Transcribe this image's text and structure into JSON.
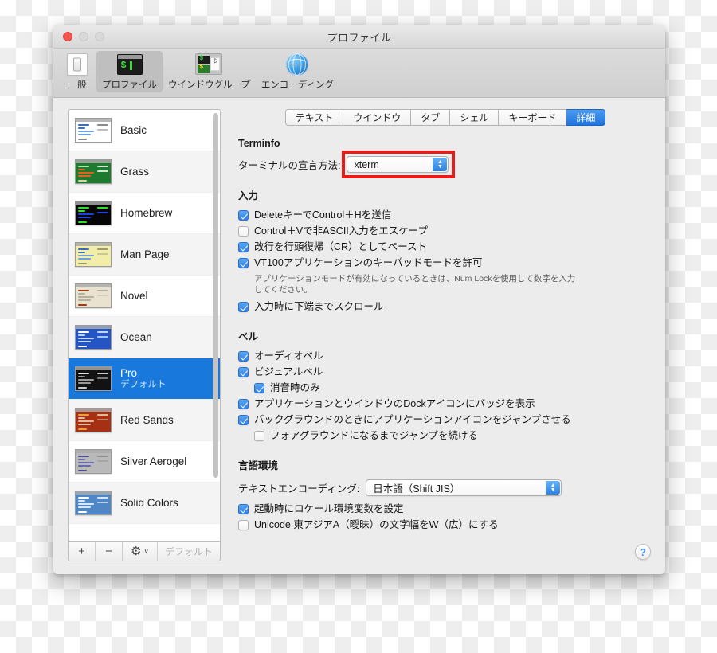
{
  "window": {
    "title": "プロファイル",
    "traffic_lights": [
      "close",
      "minimize",
      "zoom"
    ]
  },
  "toolbar": {
    "items": [
      {
        "label": "一般",
        "icon": "general-icon"
      },
      {
        "label": "プロファイル",
        "icon": "profile-terminal-icon"
      },
      {
        "label": "ウインドウグループ",
        "icon": "window-group-icon"
      },
      {
        "label": "エンコーディング",
        "icon": "globe-icon"
      }
    ],
    "selected_index": 1
  },
  "sidebar": {
    "profiles": [
      {
        "name": "Basic",
        "sub": "",
        "thumb_bg": "#ffffff",
        "thumb_fg": "#4a7fc9"
      },
      {
        "name": "Grass",
        "sub": "",
        "thumb_bg": "#1d7a2e",
        "thumb_fg": "#e8601c"
      },
      {
        "name": "Homebrew",
        "sub": "",
        "thumb_bg": "#060606",
        "thumb_fg": "#1f41e0"
      },
      {
        "name": "Man Page",
        "sub": "",
        "thumb_bg": "#f3edaa",
        "thumb_fg": "#4a7fc9"
      },
      {
        "name": "Novel",
        "sub": "",
        "thumb_bg": "#e8e2cf",
        "thumb_fg": "#9a3d12"
      },
      {
        "name": "Ocean",
        "sub": "",
        "thumb_bg": "#2554c4",
        "thumb_fg": "#9fc6f5"
      },
      {
        "name": "Pro",
        "sub": "デフォルト",
        "thumb_bg": "#121212",
        "thumb_fg": "#c9c9c9"
      },
      {
        "name": "Red Sands",
        "sub": "",
        "thumb_bg": "#a63014",
        "thumb_fg": "#e8a03a"
      },
      {
        "name": "Silver Aerogel",
        "sub": "",
        "thumb_bg": "#b9b9b9",
        "thumb_fg": "#4a4a8c"
      },
      {
        "name": "Solid Colors",
        "sub": "",
        "thumb_bg": "#4f86c6",
        "thumb_fg": "#d7e6f7"
      }
    ],
    "selected_index": 6,
    "list_toolbar": {
      "add_label": "+",
      "remove_label": "−",
      "gear_label": "⚙",
      "gear_chevron": "∨",
      "default_label": "デフォルト"
    }
  },
  "pane": {
    "tabs": [
      {
        "label": "テキスト"
      },
      {
        "label": "ウインドウ"
      },
      {
        "label": "タブ"
      },
      {
        "label": "シェル"
      },
      {
        "label": "キーボード"
      },
      {
        "label": "詳細"
      }
    ],
    "selected_tab_index": 5,
    "terminfo": {
      "section_title": "Terminfo",
      "field_label": "ターミナルの宣言方法:",
      "value": "xterm",
      "highlight_color": "#e81b1b"
    },
    "input": {
      "section_title": "入力",
      "checkboxes": [
        {
          "label": "DeleteキーでControl＋Hを送信",
          "checked": true
        },
        {
          "label": "Control＋Vで非ASCII入力をエスケープ",
          "checked": false
        },
        {
          "label": "改行を行頭復帰（CR）としてペースト",
          "checked": true
        },
        {
          "label": "VT100アプリケーションのキーパッドモードを許可",
          "checked": true
        }
      ],
      "help_text": "アプリケーションモードが有効になっているときは、Num Lockを使用して数字を入力してください。",
      "scroll_checkbox": {
        "label": "入力時に下端までスクロール",
        "checked": true
      }
    },
    "bell": {
      "section_title": "ベル",
      "checkboxes": [
        {
          "label": "オーディオベル",
          "checked": true,
          "indent": false
        },
        {
          "label": "ビジュアルベル",
          "checked": true,
          "indent": false
        },
        {
          "label": "消音時のみ",
          "checked": true,
          "indent": true
        },
        {
          "label": "アプリケーションとウインドウのDockアイコンにバッジを表示",
          "checked": true,
          "indent": false
        },
        {
          "label": "バックグラウンドのときにアプリケーションアイコンをジャンプさせる",
          "checked": true,
          "indent": false
        },
        {
          "label": "フォアグラウンドになるまでジャンプを続ける",
          "checked": false,
          "indent": true
        }
      ]
    },
    "locale": {
      "section_title": "言語環境",
      "field_label": "テキストエンコーディング:",
      "encoding_value": "日本語（Shift JIS）",
      "checkboxes": [
        {
          "label": "起動時にロケール環境変数を設定",
          "checked": true
        },
        {
          "label": "Unicode 東アジアA（曖昧）の文字幅をW（広）にする",
          "checked": false
        }
      ]
    },
    "help_button_label": "?"
  }
}
